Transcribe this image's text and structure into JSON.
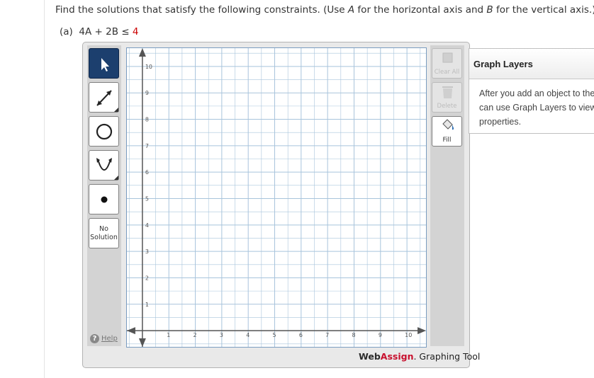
{
  "question": {
    "text_before_a": "Find the solutions that satisfy the following constraints. (Use ",
    "var_a": "A",
    "text_mid": " for the horizontal axis and ",
    "var_b": "B",
    "text_after": " for the vertical axis.)"
  },
  "part": {
    "label": "(a)",
    "expression": "4A + 2B ≤",
    "rhs": "4"
  },
  "toolbar": {
    "no_solution_line1": "No",
    "no_solution_line2": "Solution",
    "help_label": "Help"
  },
  "right_toolbar": {
    "clear_all_label": "Clear All",
    "delete_label": "Delete",
    "fill_label": "Fill"
  },
  "graph": {
    "x_range": [
      0,
      10
    ],
    "y_range": [
      0,
      10
    ],
    "x_ticks": [
      "1",
      "2",
      "3",
      "4",
      "5",
      "6",
      "7",
      "8",
      "9",
      "10"
    ],
    "y_ticks": [
      "1",
      "2",
      "3",
      "4",
      "5",
      "6",
      "7",
      "8",
      "9",
      "10"
    ],
    "minor_step": 0.5,
    "major_step": 1
  },
  "branding": {
    "web": "Web",
    "assign": "Assign",
    "suffix": ". Graphing Tool"
  },
  "layers": {
    "title": "Graph Layers",
    "line1": "After you add an object to the",
    "line2": "can use Graph Layers to view",
    "line3": "properties."
  },
  "colors": {
    "grid_line": "#a8c4dc",
    "axis": "#555555",
    "active_tool": "#1c3f6e",
    "brand_red": "#c8102e"
  }
}
